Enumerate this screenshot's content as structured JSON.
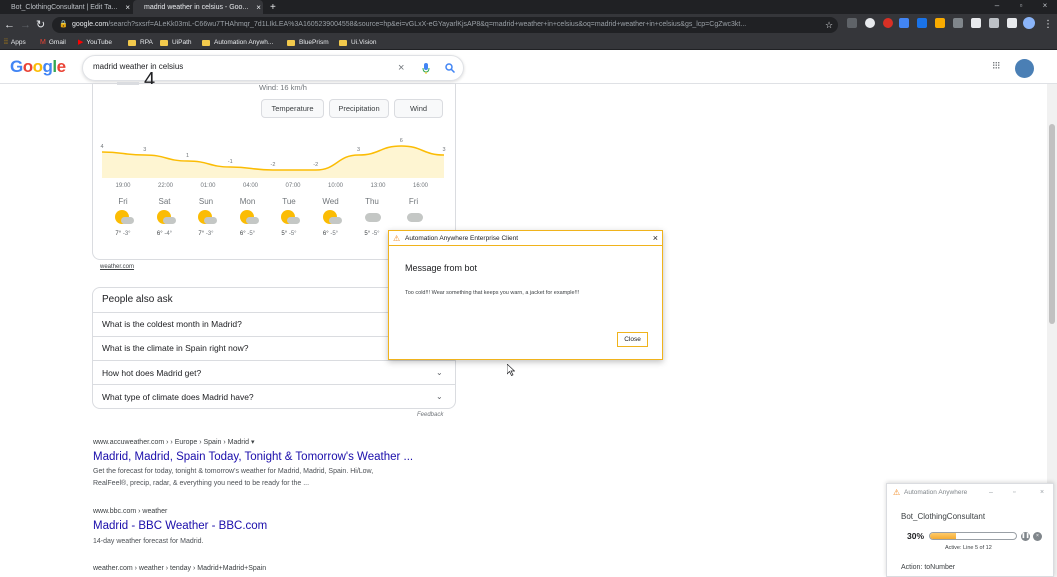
{
  "tabs": [
    {
      "label": "Bot_ClothingConsultant | Edit Ta...",
      "favicon_color": "#f08a24"
    },
    {
      "label": "madrid weather in celsius - Goo...",
      "favicon_color": "#e8eaed"
    }
  ],
  "new_tab_label": "+",
  "omnibox": {
    "host": "google.com",
    "path": "/search?sxsrf=ALeKk03mL-C66wu7THAhmqr_7d1LIkLEA%3A1605239004558&source=hp&ei=vGLxX-eGYayarlKjsAP8&q=madrid+weather+in+celsius&oq=madrid+weather+in+celsius&gs_lcp=CgZwc3kt..."
  },
  "bookmarks": [
    {
      "label": "Apps",
      "kind": "apps"
    },
    {
      "label": "Gmail",
      "kind": "gmail"
    },
    {
      "label": "YouTube",
      "kind": "youtube"
    },
    {
      "label": "RPA",
      "kind": "folder"
    },
    {
      "label": "UiPath",
      "kind": "folder"
    },
    {
      "label": "Automation Anywh...",
      "kind": "folder"
    },
    {
      "label": "BluePrism",
      "kind": "folder"
    },
    {
      "label": "Ui.Vision",
      "kind": "folder"
    }
  ],
  "google": {
    "logo": "Google",
    "query": "madrid weather in celsius"
  },
  "weather": {
    "big_temp": "4",
    "wind": "Wind: 16 km/h",
    "buttons": [
      "Temperature",
      "Precipitation",
      "Wind"
    ],
    "temp_points": [
      {
        "label": "4",
        "value": 4
      },
      {
        "label": "3",
        "value": 3
      },
      {
        "label": "1",
        "value": 1
      },
      {
        "label": "-1",
        "value": -1
      },
      {
        "label": "-2",
        "value": -2
      },
      {
        "label": "-2",
        "value": -2
      },
      {
        "label": "3",
        "value": 3
      },
      {
        "label": "6",
        "value": 6
      },
      {
        "label": "3",
        "value": 3
      }
    ],
    "times": [
      "19:00",
      "22:00",
      "01:00",
      "04:00",
      "07:00",
      "10:00",
      "13:00",
      "16:00"
    ],
    "days": [
      {
        "name": "Fri",
        "icon": "partly-cloudy",
        "high": "7°",
        "low": "-3°"
      },
      {
        "name": "Sat",
        "icon": "partly-cloudy",
        "high": "6°",
        "low": "-4°"
      },
      {
        "name": "Sun",
        "icon": "partly-cloudy",
        "high": "7°",
        "low": "-3°"
      },
      {
        "name": "Mon",
        "icon": "partly-cloudy",
        "high": "6°",
        "low": "-5°"
      },
      {
        "name": "Tue",
        "icon": "partly-cloudy",
        "high": "5°",
        "low": "-5°"
      },
      {
        "name": "Wed",
        "icon": "partly-cloudy",
        "high": "6°",
        "low": "-5°"
      },
      {
        "name": "Thu",
        "icon": "snow",
        "high": "5°",
        "low": "-5°"
      },
      {
        "name": "Fri",
        "icon": "snow",
        "high": "",
        "low": ""
      }
    ],
    "source": "weather.com"
  },
  "paa": {
    "heading": "People also ask",
    "questions": [
      "What is the coldest month in Madrid?",
      "What is the climate in Spain right now?",
      "How hot does Madrid get?",
      "What type of climate does Madrid have?"
    ],
    "feedback": "Feedback"
  },
  "results": [
    {
      "url": "www.accuweather.com ›  › Europe › Spain › Madrid ▾",
      "title": "Madrid, Madrid, Spain Today, Tonight & Tomorrow's Weather ...",
      "snippet_1": "Get the forecast for today, tonight & tomorrow's weather for Madrid, Madrid, Spain. Hi/Low,",
      "snippet_2": "RealFeel®, precip, radar, & everything you need to be ready for the ..."
    },
    {
      "url": "www.bbc.com › weather",
      "title": "Madrid - BBC Weather - BBC.com",
      "snippet_1": "14-day weather forecast for Madrid.",
      "snippet_2": ""
    },
    {
      "url": "weather.com › weather › tenday › Madrid+Madrid+Spain",
      "title": "",
      "snippet_1": "",
      "snippet_2": ""
    }
  ],
  "dialog": {
    "title": "Automation Anywhere Enterprise Client",
    "heading": "Message from bot",
    "message": "Too cold!!! Wear something that keeps you warn, a jacket for example!!!",
    "close_label": "Close"
  },
  "bot_panel": {
    "title": "Automation Anywhere",
    "bot_name": "Bot_ClothingConsultant",
    "percent_label": "30%",
    "progress_fraction": 0.3,
    "active_line": "Active: Line 5 of 12",
    "action": "Action: toNumber"
  },
  "colors": {
    "accent": "#f0b31c",
    "link": "#1a0dab",
    "chrome_dark": "#202124"
  }
}
